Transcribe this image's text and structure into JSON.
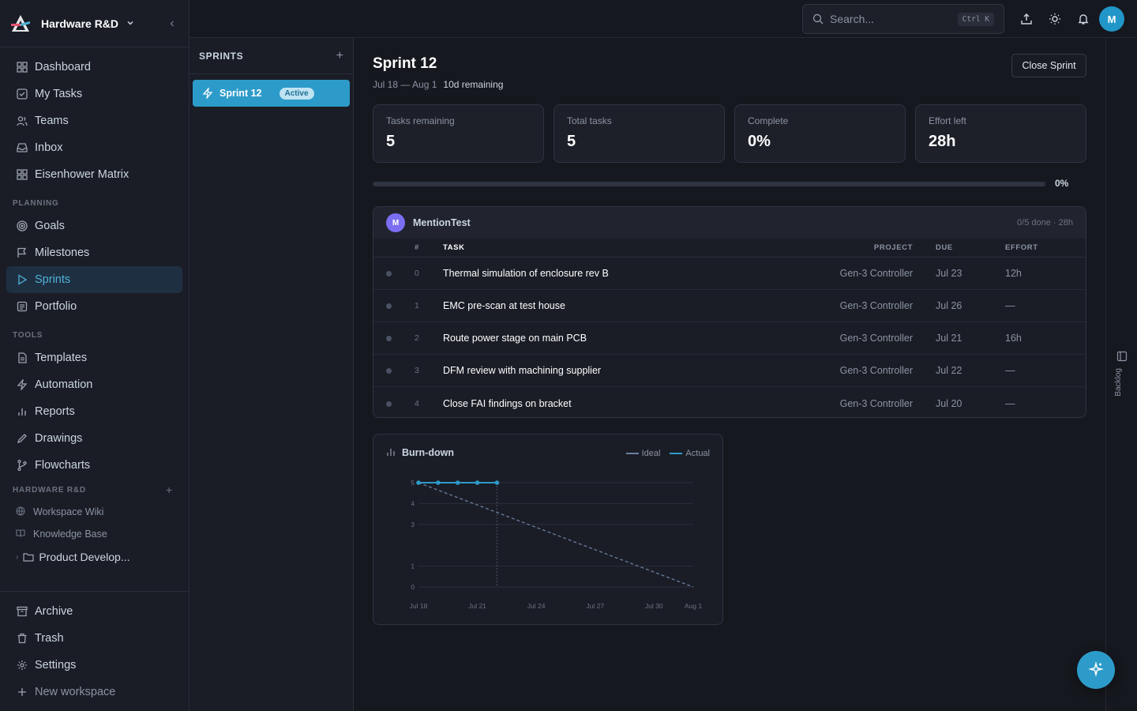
{
  "workspace": {
    "name": "Hardware R&D"
  },
  "nav": {
    "main": [
      {
        "label": "Dashboard",
        "icon": "dashboard-icon"
      },
      {
        "label": "My Tasks",
        "icon": "check-square-icon"
      },
      {
        "label": "Teams",
        "icon": "users-icon"
      },
      {
        "label": "Inbox",
        "icon": "inbox-icon"
      },
      {
        "label": "Eisenhower Matrix",
        "icon": "grid-icon"
      }
    ],
    "planning_label": "PLANNING",
    "planning": [
      {
        "label": "Goals",
        "icon": "target-icon"
      },
      {
        "label": "Milestones",
        "icon": "flag-icon"
      },
      {
        "label": "Sprints",
        "icon": "play-icon",
        "active": true
      },
      {
        "label": "Portfolio",
        "icon": "portfolio-icon"
      }
    ],
    "tools_label": "TOOLS",
    "tools": [
      {
        "label": "Templates",
        "icon": "template-icon"
      },
      {
        "label": "Automation",
        "icon": "zap-icon"
      },
      {
        "label": "Reports",
        "icon": "bar-chart-icon"
      },
      {
        "label": "Drawings",
        "icon": "pen-icon"
      },
      {
        "label": "Flowcharts",
        "icon": "git-branch-icon"
      }
    ],
    "workspace_label": "HARDWARE R&D",
    "workspace_items": [
      {
        "label": "Workspace Wiki",
        "icon": "globe-icon"
      },
      {
        "label": "Knowledge Base",
        "icon": "book-icon"
      }
    ],
    "folder": "Product Develop...",
    "bottom": [
      {
        "label": "Archive",
        "icon": "archive-icon"
      },
      {
        "label": "Trash",
        "icon": "trash-icon"
      },
      {
        "label": "Settings",
        "icon": "gear-icon"
      },
      {
        "label": "New workspace",
        "icon": "plus-icon"
      }
    ]
  },
  "topbar": {
    "search_placeholder": "Search...",
    "shortcut": "Ctrl K",
    "avatar": "M"
  },
  "sprints_panel": {
    "title": "SPRINTS",
    "items": [
      {
        "name": "Sprint 12",
        "badge": "Active"
      }
    ]
  },
  "sprint": {
    "title": "Sprint 12",
    "dates": "Jul 18 — Aug 1",
    "remaining": "10d remaining",
    "close_label": "Close Sprint",
    "stats": [
      {
        "label": "Tasks remaining",
        "value": "5"
      },
      {
        "label": "Total tasks",
        "value": "5"
      },
      {
        "label": "Complete",
        "value": "0%"
      },
      {
        "label": "Effort left",
        "value": "28h"
      }
    ],
    "progress": 0,
    "progress_label": "0%"
  },
  "group": {
    "avatar": "M",
    "name": "MentionTest",
    "meta": "0/5 done · 28h",
    "columns": {
      "num": "#",
      "task": "TASK",
      "project": "PROJECT",
      "due": "DUE",
      "effort": "EFFORT"
    },
    "rows": [
      {
        "num": "0",
        "task": "Thermal simulation of enclosure rev B",
        "project": "Gen-3 Controller",
        "due": "Jul 23",
        "effort": "12h"
      },
      {
        "num": "1",
        "task": "EMC pre-scan at test house",
        "project": "Gen-3 Controller",
        "due": "Jul 26",
        "effort": "—"
      },
      {
        "num": "2",
        "task": "Route power stage on main PCB",
        "project": "Gen-3 Controller",
        "due": "Jul 21",
        "effort": "16h"
      },
      {
        "num": "3",
        "task": "DFM review with machining supplier",
        "project": "Gen-3 Controller",
        "due": "Jul 22",
        "effort": "—"
      },
      {
        "num": "4",
        "task": "Close FAI findings on bracket",
        "project": "Gen-3 Controller",
        "due": "Jul 20",
        "effort": "—"
      }
    ]
  },
  "chart_data": {
    "type": "line",
    "title": "Burn-down",
    "x_ticks": [
      "Jul 18",
      "Jul 21",
      "Jul 24",
      "Jul 27",
      "Jul 30",
      "Aug 1"
    ],
    "y_ticks": [
      0,
      1,
      3,
      4,
      5
    ],
    "ylim": [
      0,
      5
    ],
    "xlim": [
      0,
      14
    ],
    "series": [
      {
        "name": "Ideal",
        "x": [
          0,
          14
        ],
        "y": [
          5,
          0
        ],
        "color": "#6b7fa0",
        "dashed": true
      },
      {
        "name": "Actual",
        "x": [
          0,
          1,
          2,
          3,
          4
        ],
        "y": [
          5,
          5,
          5,
          5,
          5
        ],
        "color": "#2d9bc9"
      }
    ],
    "today_x": 4,
    "legend": "top-right"
  },
  "backlog_label": "Backlog",
  "colors": {
    "accent": "#2d9bc9",
    "bg": "#16181f"
  }
}
